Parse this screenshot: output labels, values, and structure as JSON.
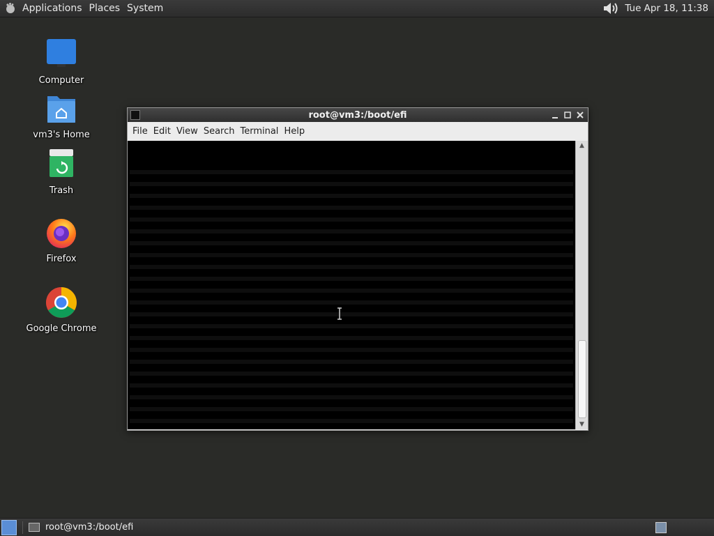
{
  "top_panel": {
    "menus": [
      "Applications",
      "Places",
      "System"
    ],
    "clock": "Tue Apr 18, 11:38"
  },
  "desktop_icons": [
    {
      "label": "Computer",
      "icon": "computer-icon"
    },
    {
      "label": "vm3's Home",
      "icon": "home-folder-icon"
    },
    {
      "label": "Trash",
      "icon": "trash-icon"
    },
    {
      "label": "Firefox",
      "icon": "firefox-icon"
    },
    {
      "label": "Google Chrome",
      "icon": "chrome-icon"
    }
  ],
  "terminal": {
    "title": "root@vm3:/boot/efi",
    "menu": [
      "File",
      "Edit",
      "View",
      "Search",
      "Terminal",
      "Help"
    ]
  },
  "taskbar": {
    "task_label": "root@vm3:/boot/efi"
  },
  "colors": {
    "desktop_bg": "#2a2b28",
    "terminal_bg": "#000000",
    "panel_bg": "#333333"
  }
}
